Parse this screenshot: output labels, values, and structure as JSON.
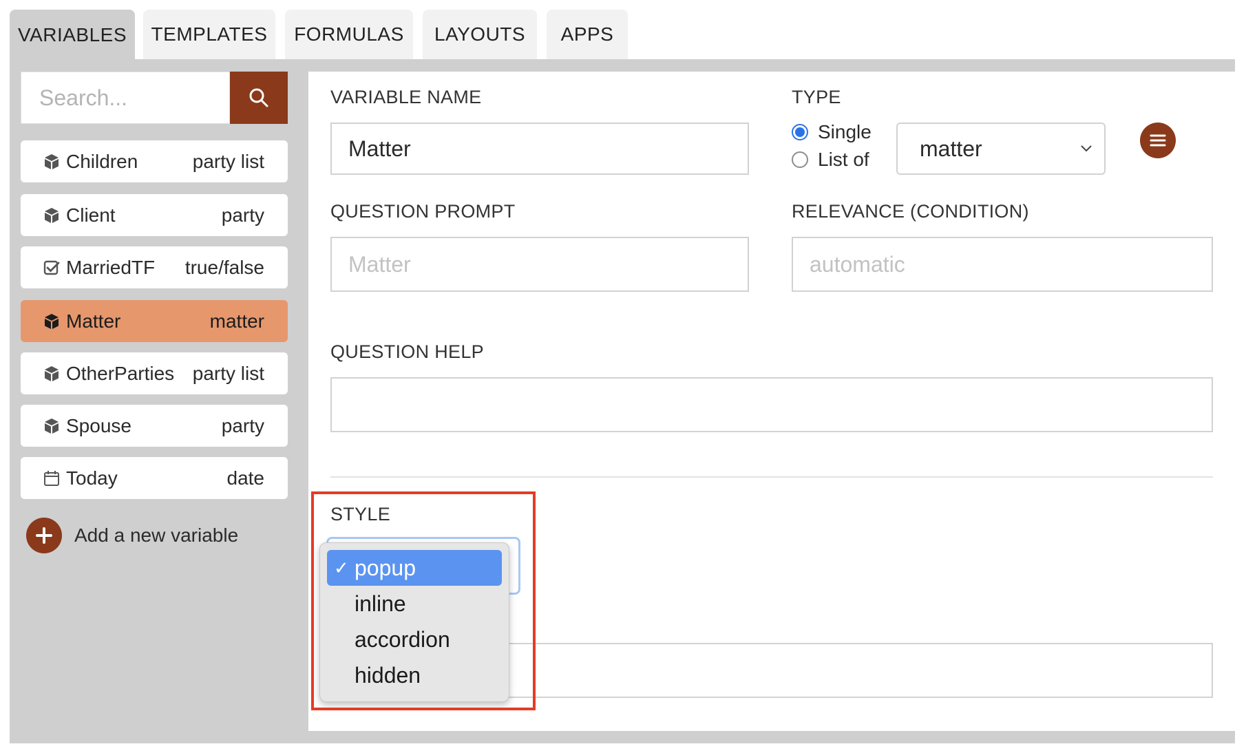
{
  "tabs": [
    {
      "label": "VARIABLES",
      "active": true
    },
    {
      "label": "TEMPLATES",
      "active": false
    },
    {
      "label": "FORMULAS",
      "active": false
    },
    {
      "label": "LAYOUTS",
      "active": false
    },
    {
      "label": "APPS",
      "active": false
    }
  ],
  "sidebar": {
    "search_placeholder": "Search...",
    "search_icon": "search-icon",
    "items": [
      {
        "name": "Children",
        "type": "party list",
        "icon": "cube-icon",
        "selected": false
      },
      {
        "name": "Client",
        "type": "party",
        "icon": "cube-icon",
        "selected": false
      },
      {
        "name": "MarriedTF",
        "type": "true/false",
        "icon": "checkbox-icon",
        "selected": false
      },
      {
        "name": "Matter",
        "type": "matter",
        "icon": "cube-icon",
        "selected": true
      },
      {
        "name": "OtherParties",
        "type": "party list",
        "icon": "cube-icon",
        "selected": false
      },
      {
        "name": "Spouse",
        "type": "party",
        "icon": "cube-icon",
        "selected": false
      },
      {
        "name": "Today",
        "type": "date",
        "icon": "calendar-icon",
        "selected": false
      }
    ],
    "add_label": "Add a new variable"
  },
  "editor": {
    "variable_name_label": "VARIABLE NAME",
    "variable_name_value": "Matter",
    "type_label": "TYPE",
    "type_options": {
      "single": "Single",
      "list_of": "List of",
      "selected": "single"
    },
    "type_select_value": "matter",
    "question_prompt_label": "QUESTION PROMPT",
    "question_prompt_placeholder": "Matter",
    "relevance_label": "RELEVANCE (CONDITION)",
    "relevance_placeholder": "automatic",
    "question_help_label": "QUESTION HELP",
    "question_help_value": "",
    "style_label": "STYLE",
    "style_options": [
      "popup",
      "inline",
      "accordion",
      "hidden"
    ],
    "style_selected": "popup",
    "check_mark": "✓"
  },
  "colors": {
    "accent": "#8a3a1a",
    "selected_item": "#e6976c",
    "dropdown_highlight": "#5b94f0",
    "annotation_box": "#e53c25"
  }
}
